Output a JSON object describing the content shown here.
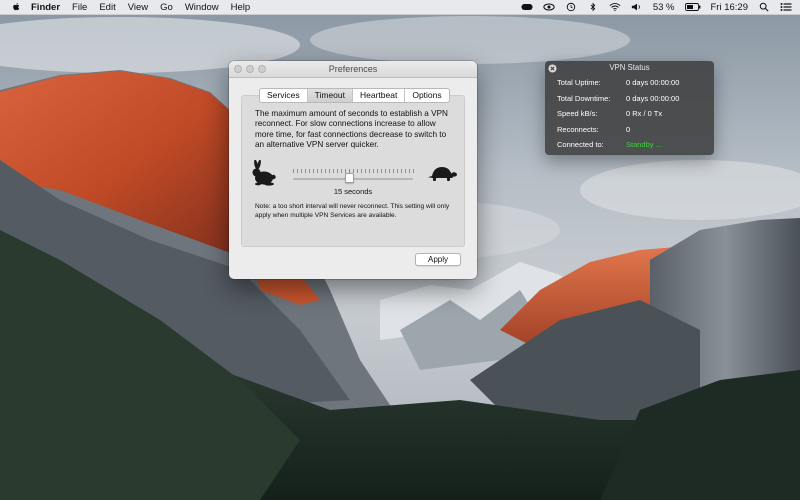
{
  "menubar": {
    "app_name": "Finder",
    "items": [
      "File",
      "Edit",
      "View",
      "Go",
      "Window",
      "Help"
    ],
    "battery_percent": "53 %",
    "clock": "Fri 16:29"
  },
  "preferences": {
    "title": "Preferences",
    "tabs": [
      "Services",
      "Timeout",
      "Heartbeat",
      "Options"
    ],
    "selected_tab": "Timeout",
    "description": "The maximum amount of seconds to establish a VPN reconnect. For slow connections increase to allow more time, for fast connections decrease to switch to an alternative VPN server quicker.",
    "slider_value_label": "15 seconds",
    "slider_fraction": 0.47,
    "note": "Note: a too short interval will never reconnect. This setting will only apply when multiple VPN Services are available.",
    "apply_label": "Apply"
  },
  "vpn_status": {
    "title": "VPN Status",
    "rows": [
      {
        "label": "Total Uptime:",
        "value": "0 days 00:00:00"
      },
      {
        "label": "Total Downtime:",
        "value": "0 days 00:00:00"
      },
      {
        "label": "Speed kB/s:",
        "value": "0 Rx / 0 Tx"
      },
      {
        "label": "Reconnects:",
        "value": "0"
      },
      {
        "label": "Connected to:",
        "value": "Standby ..."
      }
    ],
    "standby_color": "#39d33a"
  },
  "icons": {
    "menubar_right": [
      "vpn-status-icon",
      "eye-icon",
      "time-machine-icon",
      "bluetooth-icon",
      "wifi-icon",
      "volume-icon",
      "battery-icon",
      "search-icon",
      "notification-center-icon"
    ],
    "prefs": [
      "rabbit-icon",
      "turtle-icon"
    ]
  }
}
